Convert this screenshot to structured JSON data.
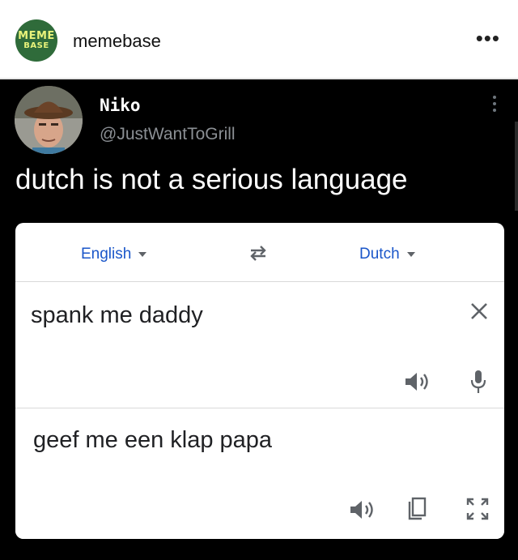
{
  "header": {
    "logo_line1": "MEME",
    "logo_line2": "BASE",
    "account_name": "memebase",
    "more_label": "•••"
  },
  "tweet": {
    "author_name": "Niko",
    "author_handle": "@JustWantToGrill",
    "text": "dutch is not a serious language"
  },
  "translate": {
    "source_language": "English",
    "target_language": "Dutch",
    "source_text": "spank me daddy",
    "translated_text": "geef me een klap papa"
  },
  "colors": {
    "link_blue": "#1a56c9",
    "logo_green": "#2f6b3a",
    "icon_gray": "#5f6368"
  }
}
